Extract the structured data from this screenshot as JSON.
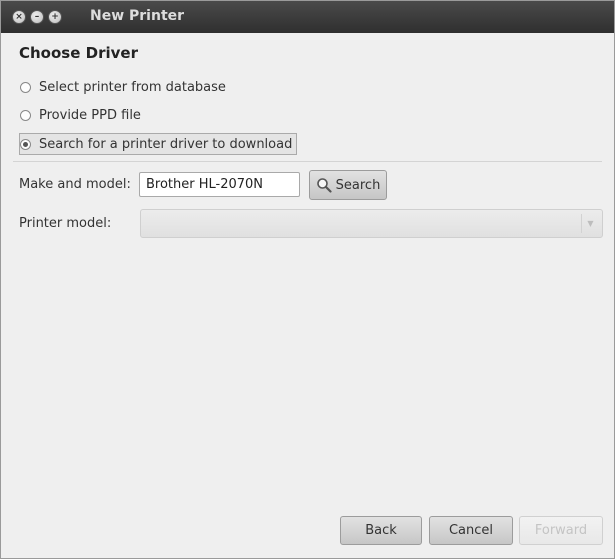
{
  "window": {
    "title": "New Printer",
    "controls": {
      "close": "×",
      "minimize": "–",
      "maximize": "+"
    }
  },
  "page": {
    "heading": "Choose Driver",
    "options": [
      {
        "label": "Select printer from database",
        "checked": false
      },
      {
        "label": "Provide PPD file",
        "checked": false
      },
      {
        "label": "Search for a printer driver to download",
        "checked": true
      }
    ]
  },
  "search": {
    "label": "Make and model:",
    "value": "Brother HL-2070N",
    "button_label": "Search",
    "button_icon": "magnifier-icon"
  },
  "model": {
    "label": "Printer model:",
    "value": "",
    "arrow": "▼"
  },
  "footer": {
    "back_label": "Back",
    "cancel_label": "Cancel",
    "forward_label": "Forward",
    "forward_enabled": false
  }
}
